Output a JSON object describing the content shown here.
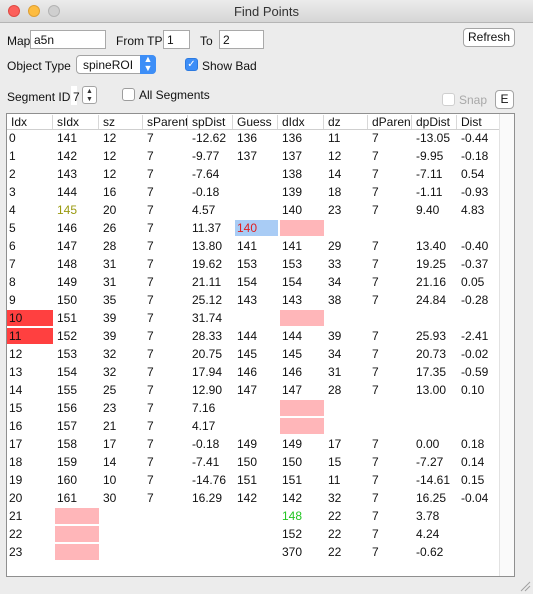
{
  "window": {
    "title": "Find Points"
  },
  "controls": {
    "map_label": "Map",
    "map_value": "a5n",
    "from_tp_label": "From TP",
    "from_tp_value": "1",
    "to_label": "To",
    "to_value": "2",
    "refresh_label": "Refresh",
    "object_type_label": "Object Type",
    "object_type_value": "spineROI",
    "show_bad_label": "Show Bad",
    "show_bad_checked": true,
    "segment_id_label": "Segment ID",
    "segment_id_value": "7",
    "all_segments_label": "All Segments",
    "all_segments_checked": false,
    "snap_label": "Snap",
    "snap_checked": false,
    "e_button_label": "E"
  },
  "table": {
    "columns": [
      "Idx",
      "sIdx",
      "sz",
      "sParent",
      "spDist",
      "Guess",
      "dIdx",
      "dz",
      "dParent",
      "dpDist",
      "Dist"
    ],
    "rows": [
      [
        "0",
        "141",
        "12",
        "7",
        "-12.62",
        "136",
        "136",
        "11",
        "7",
        "-13.05",
        "-0.44"
      ],
      [
        "1",
        "142",
        "12",
        "7",
        "-9.77",
        "137",
        "137",
        "12",
        "7",
        "-9.95",
        "-0.18"
      ],
      [
        "2",
        "143",
        "12",
        "7",
        "-7.64",
        "",
        "138",
        "14",
        "7",
        "-7.11",
        "0.54"
      ],
      [
        "3",
        "144",
        "16",
        "7",
        "-0.18",
        "",
        "139",
        "18",
        "7",
        "-1.11",
        "-0.93"
      ],
      [
        "4",
        "145",
        "20",
        "7",
        "4.57",
        "",
        "140",
        "23",
        "7",
        "9.40",
        "4.83"
      ],
      [
        "5",
        "146",
        "26",
        "7",
        "11.37",
        "140",
        "",
        "",
        "",
        "",
        ""
      ],
      [
        "6",
        "147",
        "28",
        "7",
        "13.80",
        "141",
        "141",
        "29",
        "7",
        "13.40",
        "-0.40"
      ],
      [
        "7",
        "148",
        "31",
        "7",
        "19.62",
        "153",
        "153",
        "33",
        "7",
        "19.25",
        "-0.37"
      ],
      [
        "8",
        "149",
        "31",
        "7",
        "21.11",
        "154",
        "154",
        "34",
        "7",
        "21.16",
        "0.05"
      ],
      [
        "9",
        "150",
        "35",
        "7",
        "25.12",
        "143",
        "143",
        "38",
        "7",
        "24.84",
        "-0.28"
      ],
      [
        "10",
        "151",
        "39",
        "7",
        "31.74",
        "",
        "",
        "",
        "",
        "",
        ""
      ],
      [
        "11",
        "152",
        "39",
        "7",
        "28.33",
        "144",
        "144",
        "39",
        "7",
        "25.93",
        "-2.41"
      ],
      [
        "12",
        "153",
        "32",
        "7",
        "20.75",
        "145",
        "145",
        "34",
        "7",
        "20.73",
        "-0.02"
      ],
      [
        "13",
        "154",
        "32",
        "7",
        "17.94",
        "146",
        "146",
        "31",
        "7",
        "17.35",
        "-0.59"
      ],
      [
        "14",
        "155",
        "25",
        "7",
        "12.90",
        "147",
        "147",
        "28",
        "7",
        "13.00",
        "0.10"
      ],
      [
        "15",
        "156",
        "23",
        "7",
        "7.16",
        "",
        "",
        "",
        "",
        "",
        ""
      ],
      [
        "16",
        "157",
        "21",
        "7",
        "4.17",
        "",
        "",
        "",
        "",
        "",
        ""
      ],
      [
        "17",
        "158",
        "17",
        "7",
        "-0.18",
        "149",
        "149",
        "17",
        "7",
        "0.00",
        "0.18"
      ],
      [
        "18",
        "159",
        "14",
        "7",
        "-7.41",
        "150",
        "150",
        "15",
        "7",
        "-7.27",
        "0.14"
      ],
      [
        "19",
        "160",
        "10",
        "7",
        "-14.76",
        "151",
        "151",
        "11",
        "7",
        "-14.61",
        "0.15"
      ],
      [
        "20",
        "161",
        "30",
        "7",
        "16.29",
        "142",
        "142",
        "32",
        "7",
        "16.25",
        "-0.04"
      ],
      [
        "21",
        "",
        "",
        "",
        "",
        "",
        "148",
        "22",
        "7",
        "3.78",
        ""
      ],
      [
        "22",
        "",
        "",
        "",
        "",
        "",
        "152",
        "22",
        "7",
        "4.24",
        ""
      ],
      [
        "23",
        "",
        "",
        "",
        "",
        "",
        "370",
        "22",
        "7",
        "-0.62",
        ""
      ]
    ],
    "highlights": {
      "missing_cell_color": "#ffb6b9",
      "bad_idx_color": "#ff4040",
      "guess_selected_color": "#a9ccf5",
      "guess_selected_text_color": "#e02020",
      "olive_text_color": "#9a9a10",
      "green_text_color": "#22c522"
    }
  }
}
